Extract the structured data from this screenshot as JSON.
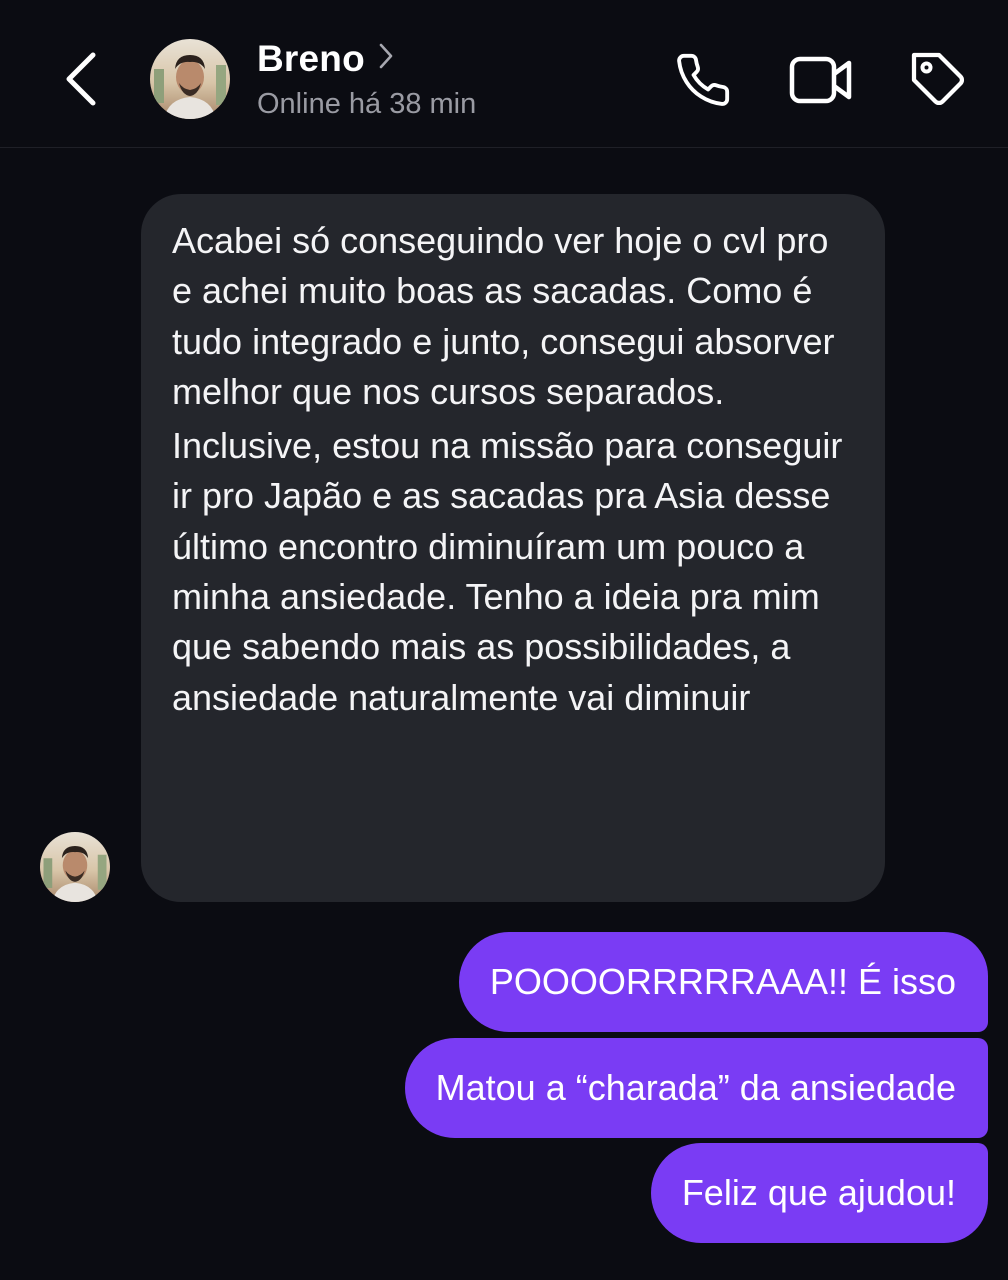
{
  "header": {
    "back_icon": "chevron-left-icon",
    "contact_name": "Breno",
    "name_chevron_icon": "chevron-right-icon",
    "status": "Online há 38 min",
    "actions": {
      "call_icon": "phone-icon",
      "video_icon": "video-camera-icon",
      "tag_icon": "tag-icon"
    }
  },
  "colors": {
    "background": "#0b0c12",
    "incoming_bubble": "#24262c",
    "outgoing_bubble": "#7a3cf4",
    "muted_text": "#9a9ba3"
  },
  "messages": {
    "incoming": {
      "paragraphs": [
        "Acabei só conseguindo ver hoje o cvl pro e achei muito boas as sacadas. Como é tudo integrado e junto, consegui absorver melhor que nos cursos separados.",
        "Inclusive, estou na missão para conseguir ir pro Japão  e as sacadas pra Asia desse último encontro diminuíram um pouco a minha ansiedade. Tenho a ideia pra mim que sabendo mais as possibilidades, a ansiedade naturalmente vai diminuir"
      ]
    },
    "outgoing": [
      "POOOORRRRRAAA!! É isso",
      "Matou a “charada” da ansiedade",
      "Feliz que ajudou!"
    ]
  }
}
